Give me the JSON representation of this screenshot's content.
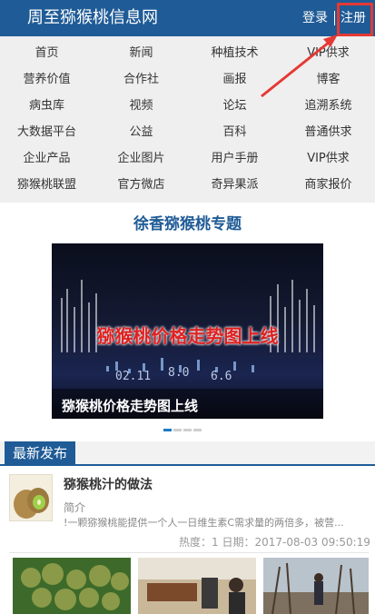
{
  "header": {
    "title": "周至猕猴桃信息网",
    "login": "登录",
    "register": "注册",
    "colors": {
      "bar": "#1f5b96",
      "highlight": "#e53935"
    }
  },
  "nav": {
    "rows": [
      [
        "首页",
        "新闻",
        "种植技术",
        "VIP供求"
      ],
      [
        "营养价值",
        "合作社",
        "画报",
        "博客"
      ],
      [
        "病虫库",
        "视频",
        "论坛",
        "追溯系统"
      ],
      [
        "大数据平台",
        "公益",
        "百科",
        "普通供求"
      ],
      [
        "企业产品",
        "企业图片",
        "用户手册",
        "VIP供求"
      ],
      [
        "猕猴桃联盟",
        "官方微店",
        "奇异果派",
        "商家报价"
      ]
    ]
  },
  "feature": {
    "title": "徐香猕猴桃专题",
    "banner_headline": "猕猴桃价格走势图上线",
    "caption": "猕猴桃价格走势图上线",
    "slide_count": 4,
    "active_slide": 1
  },
  "latest": {
    "tag": "最新发布",
    "article": {
      "title": "猕猴桃汁的做法",
      "label": "简介",
      "summary": "!一颗猕猴桃能提供一个人一日维生素C需求量的两倍多，被营...",
      "meta": "热度：1  日期：2017-08-03 09:50:19"
    }
  }
}
